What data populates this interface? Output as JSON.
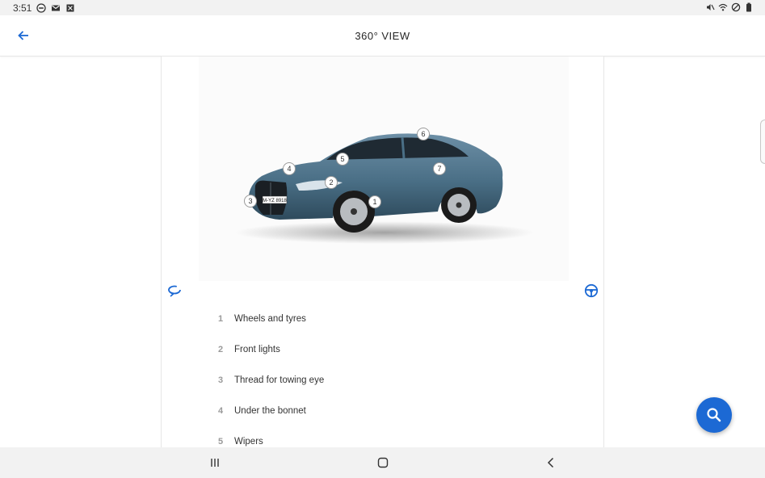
{
  "status_bar": {
    "time": "3:51",
    "left_icons": [
      "do-not-disturb-icon",
      "gmail-icon",
      "app-notification-icon"
    ],
    "right_icons": [
      "mute-icon",
      "wifi-icon",
      "block-icon",
      "battery-icon"
    ]
  },
  "header": {
    "title": "360° VIEW",
    "back_icon": "arrow-left-icon"
  },
  "car_view": {
    "hotspots": [
      "1",
      "2",
      "3",
      "4",
      "5",
      "6",
      "7"
    ],
    "plate_text": "M-YZ 8918",
    "rotate_icon": "rotate-360-icon",
    "interior_icon": "steering-wheel-icon"
  },
  "items": [
    {
      "num": "1",
      "label": "Wheels and tyres"
    },
    {
      "num": "2",
      "label": "Front lights"
    },
    {
      "num": "3",
      "label": "Thread for towing eye"
    },
    {
      "num": "4",
      "label": "Under the bonnet"
    },
    {
      "num": "5",
      "label": "Wipers"
    }
  ],
  "fab": {
    "icon": "search-icon"
  },
  "colors": {
    "accent": "#1c69d4",
    "car_body": "#4a6f86",
    "background": "#ffffff",
    "bars": "#f2f2f2"
  },
  "nav_bar": {
    "icons": [
      "recent-apps-icon",
      "home-icon",
      "back-nav-icon"
    ]
  }
}
